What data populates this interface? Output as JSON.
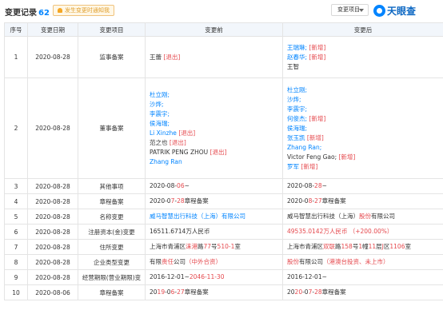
{
  "header": {
    "title": "变更记录",
    "count": "62",
    "notify_label": "发生变更时通知我",
    "filter_select": "变更项目",
    "logo_text": "天眼查"
  },
  "table": {
    "columns": [
      "序号",
      "变更日期",
      "变更项目",
      "变更前",
      "变更后"
    ],
    "rows": [
      {
        "no": "1",
        "date": "2020-08-28",
        "item": "监事备案",
        "before": [
          [
            {
              "t": "王蕾 ",
              "c": ""
            },
            {
              "t": "[退出]",
              "c": "red"
            }
          ]
        ],
        "after": [
          [
            {
              "t": "王瑞琳; ",
              "c": "blue"
            },
            {
              "t": "[新增]",
              "c": "red"
            }
          ],
          [
            {
              "t": "赵春华; ",
              "c": "blue"
            },
            {
              "t": "[新增]",
              "c": "red"
            }
          ],
          [
            {
              "t": "王智",
              "c": ""
            }
          ]
        ]
      },
      {
        "no": "2",
        "date": "2020-08-28",
        "item": "董事备案",
        "before": [
          [
            {
              "t": "杜立刚;",
              "c": "blue"
            }
          ],
          [
            {
              "t": "沙烨;",
              "c": "blue"
            }
          ],
          [
            {
              "t": "李震宇;",
              "c": "blue"
            }
          ],
          [
            {
              "t": "侯海瑞;",
              "c": "blue"
            }
          ],
          [
            {
              "t": "Li Xinzhe ",
              "c": "blue"
            },
            {
              "t": "[退出]",
              "c": "red"
            }
          ],
          [
            {
              "t": "范之也 ",
              "c": ""
            },
            {
              "t": "[退出]",
              "c": "red"
            }
          ],
          [
            {
              "t": "PATRIK PENG ZHOU ",
              "c": ""
            },
            {
              "t": "[退出]",
              "c": "red"
            }
          ],
          [
            {
              "t": "Zhang Ran",
              "c": "blue"
            }
          ]
        ],
        "after": [
          [
            {
              "t": "杜立刚;",
              "c": "blue"
            }
          ],
          [
            {
              "t": "沙烨;",
              "c": "blue"
            }
          ],
          [
            {
              "t": "李震宇;",
              "c": "blue"
            }
          ],
          [
            {
              "t": "何俊杰; ",
              "c": "blue"
            },
            {
              "t": "[新增]",
              "c": "red"
            }
          ],
          [
            {
              "t": "侯海瑞;",
              "c": "blue"
            }
          ],
          [
            {
              "t": "张玉凯 ",
              "c": "blue"
            },
            {
              "t": "[新增]",
              "c": "red"
            }
          ],
          [
            {
              "t": "Zhang Ran;",
              "c": "blue"
            }
          ],
          [
            {
              "t": "Victor Feng Gao; ",
              "c": ""
            },
            {
              "t": "[新增]",
              "c": "red"
            }
          ],
          [
            {
              "t": "罗军 ",
              "c": "blue"
            },
            {
              "t": "[新增]",
              "c": "red"
            }
          ]
        ]
      },
      {
        "no": "3",
        "date": "2020-08-28",
        "item": "其他事项",
        "before": [
          [
            {
              "t": "2020-08-",
              "c": ""
            },
            {
              "t": "06",
              "c": "red"
            },
            {
              "t": "~",
              "c": ""
            }
          ]
        ],
        "after": [
          [
            {
              "t": "2020-08-",
              "c": ""
            },
            {
              "t": "28",
              "c": "red"
            },
            {
              "t": "~",
              "c": ""
            }
          ]
        ]
      },
      {
        "no": "4",
        "date": "2020-08-28",
        "item": "章程备案",
        "before": [
          [
            {
              "t": "2020-0",
              "c": ""
            },
            {
              "t": "7",
              "c": "red"
            },
            {
              "t": "-",
              "c": ""
            },
            {
              "t": "28",
              "c": "red"
            },
            {
              "t": "章程备案",
              "c": ""
            }
          ]
        ],
        "after": [
          [
            {
              "t": "2020-0",
              "c": ""
            },
            {
              "t": "8",
              "c": "red"
            },
            {
              "t": "-",
              "c": ""
            },
            {
              "t": "27",
              "c": "red"
            },
            {
              "t": "章程备案",
              "c": ""
            }
          ]
        ]
      },
      {
        "no": "5",
        "date": "2020-08-28",
        "item": "名称变更",
        "before": [
          [
            {
              "t": "威马智慧出行科技（上海）有限公司",
              "c": "blue"
            }
          ]
        ],
        "after": [
          [
            {
              "t": "威马智慧出行科技（上海）",
              "c": ""
            },
            {
              "t": "股份",
              "c": "red"
            },
            {
              "t": "有限公司",
              "c": ""
            }
          ]
        ]
      },
      {
        "no": "6",
        "date": "2020-08-28",
        "item": "注册资本(金)变更",
        "before": [
          [
            {
              "t": "16511.6714万人民币",
              "c": ""
            }
          ]
        ],
        "after": [
          [
            {
              "t": "49535.0142万人民币 （+200.00%）",
              "c": "red"
            }
          ]
        ]
      },
      {
        "no": "7",
        "date": "2020-08-28",
        "item": "住所变更",
        "before": [
          [
            {
              "t": "上海市青浦区",
              "c": ""
            },
            {
              "t": "涞港",
              "c": "red"
            },
            {
              "t": "路",
              "c": ""
            },
            {
              "t": "77",
              "c": "red"
            },
            {
              "t": "号",
              "c": ""
            },
            {
              "t": "510-1",
              "c": "red"
            },
            {
              "t": "室",
              "c": ""
            }
          ]
        ],
        "after": [
          [
            {
              "t": "上海市青浦区",
              "c": ""
            },
            {
              "t": "双联",
              "c": "red"
            },
            {
              "t": "路",
              "c": ""
            },
            {
              "t": "158",
              "c": "red"
            },
            {
              "t": "号",
              "c": ""
            },
            {
              "t": "1",
              "c": "red"
            },
            {
              "t": "幢",
              "c": ""
            },
            {
              "t": "11",
              "c": "red"
            },
            {
              "t": "层",
              "c": ""
            },
            {
              "t": "J",
              "c": "red"
            },
            {
              "t": "区",
              "c": ""
            },
            {
              "t": "1106",
              "c": "red"
            },
            {
              "t": "室",
              "c": ""
            }
          ]
        ]
      },
      {
        "no": "8",
        "date": "2020-08-28",
        "item": "企业类型变更",
        "before": [
          [
            {
              "t": "有限",
              "c": ""
            },
            {
              "t": "责任",
              "c": "red"
            },
            {
              "t": "公司",
              "c": ""
            },
            {
              "t": "（中外合资）",
              "c": "red"
            }
          ]
        ],
        "after": [
          [
            {
              "t": "股份",
              "c": "red"
            },
            {
              "t": "有限公司",
              "c": ""
            },
            {
              "t": "（港澳台投资、未上市）",
              "c": "red"
            }
          ]
        ]
      },
      {
        "no": "9",
        "date": "2020-08-28",
        "item": "经营期限(营业期限)变",
        "before": [
          [
            {
              "t": "2016-12-01~",
              "c": ""
            },
            {
              "t": "2046-11-30",
              "c": "red"
            }
          ]
        ],
        "after": [
          [
            {
              "t": "2016-12-01~",
              "c": ""
            }
          ]
        ]
      },
      {
        "no": "10",
        "date": "2020-08-06",
        "item": "章程备案",
        "before": [
          [
            {
              "t": "20",
              "c": ""
            },
            {
              "t": "19",
              "c": "red"
            },
            {
              "t": "-0",
              "c": ""
            },
            {
              "t": "6",
              "c": "red"
            },
            {
              "t": "-",
              "c": ""
            },
            {
              "t": "27",
              "c": "red"
            },
            {
              "t": "章程备案",
              "c": ""
            }
          ]
        ],
        "after": [
          [
            {
              "t": "20",
              "c": ""
            },
            {
              "t": "20",
              "c": "red"
            },
            {
              "t": "-0",
              "c": ""
            },
            {
              "t": "7",
              "c": "red"
            },
            {
              "t": "-",
              "c": ""
            },
            {
              "t": "28",
              "c": "red"
            },
            {
              "t": "章程备案",
              "c": ""
            }
          ]
        ]
      }
    ]
  }
}
